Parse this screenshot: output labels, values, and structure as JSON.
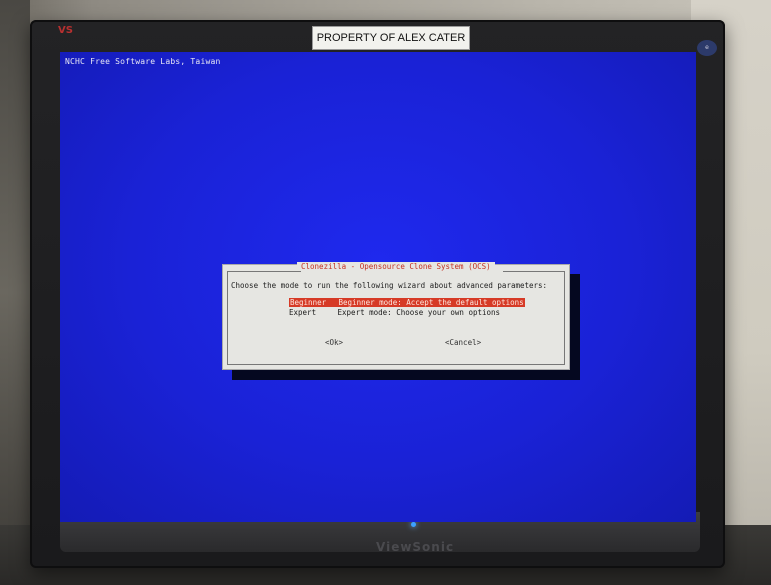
{
  "monitor": {
    "property_label": "PROPERTY OF ALEX CATER",
    "brand_logo": "VS",
    "brand_name": "ViewSonic"
  },
  "screen": {
    "header": "NCHC Free Software Labs, Taiwan",
    "background_color": "#1a22d6"
  },
  "dialog": {
    "title": "Clonezilla - Opensource Clone System (OCS)",
    "prompt": "Choose the mode to run the following wizard about advanced parameters:",
    "options": [
      {
        "tag": "Beginner",
        "description": "Beginner mode: Accept the default options",
        "selected": true
      },
      {
        "tag": "Expert",
        "description": "Expert mode: Choose your own options",
        "selected": false
      }
    ],
    "ok_label": "<Ok>",
    "cancel_label": "<Cancel>",
    "highlight_color": "#d63a26",
    "title_color": "#c43022"
  }
}
